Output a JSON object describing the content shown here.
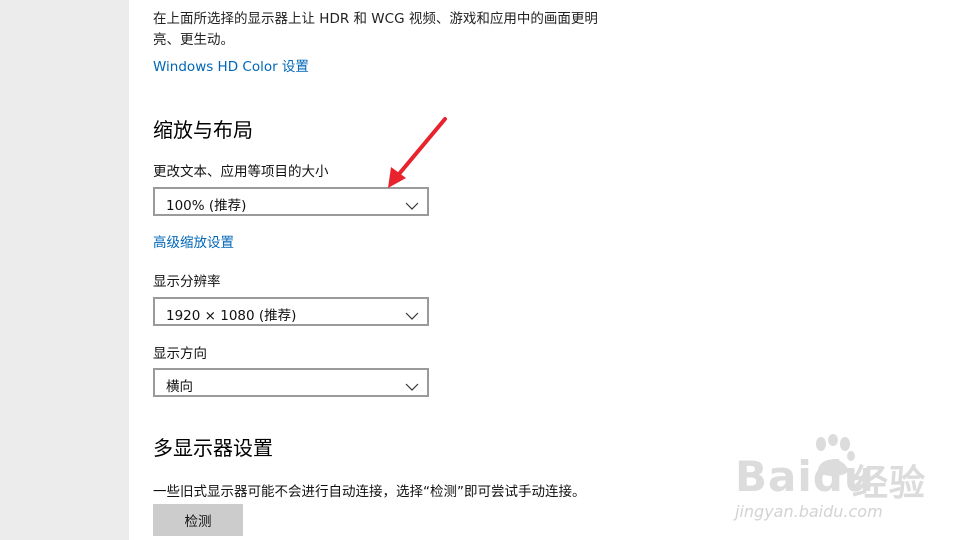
{
  "hdr": {
    "description": "在上面所选择的显示器上让 HDR 和 WCG 视频、游戏和应用中的画面更明亮、更生动。",
    "link": "Windows HD Color 设置"
  },
  "scale_layout": {
    "title": "缩放与布局",
    "text_size_label": "更改文本、应用等项目的大小",
    "text_size_value": "100% (推荐)",
    "advanced_link": "高级缩放设置",
    "resolution_label": "显示分辨率",
    "resolution_value": "1920 × 1080 (推荐)",
    "orientation_label": "显示方向",
    "orientation_value": "横向"
  },
  "multi_display": {
    "title": "多显示器设置",
    "description": "一些旧式显示器可能不会进行自动连接，选择“检测”即可尝试手动连接。",
    "detect_button": "检测"
  },
  "watermark": {
    "brand": "Baidu",
    "brand_cn": "经验",
    "url": "jingyan.baidu.com"
  },
  "colors": {
    "sidebar_bg": "#ececec",
    "link": "#0067b8",
    "annotation_arrow": "#e8232d"
  }
}
